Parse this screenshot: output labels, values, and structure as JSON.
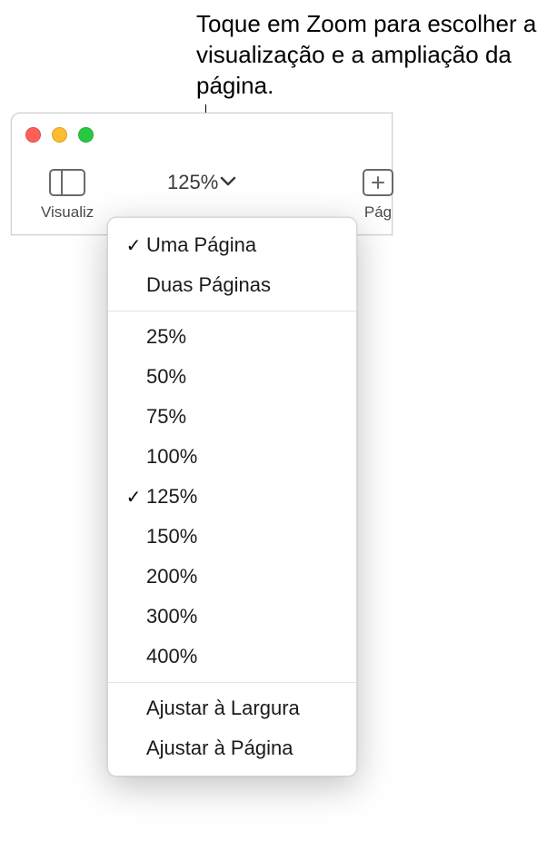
{
  "callout": {
    "text": "Toque em Zoom para escolher a visualização e a ampliação da página."
  },
  "toolbar": {
    "view_label": "Visualiz",
    "zoom_value": "125%",
    "page_label": "Pág"
  },
  "menu": {
    "view_modes": [
      {
        "label": "Uma Página",
        "checked": true
      },
      {
        "label": "Duas Páginas",
        "checked": false
      }
    ],
    "zoom_levels": [
      {
        "label": "25%",
        "checked": false
      },
      {
        "label": "50%",
        "checked": false
      },
      {
        "label": "75%",
        "checked": false
      },
      {
        "label": "100%",
        "checked": false
      },
      {
        "label": "125%",
        "checked": true
      },
      {
        "label": "150%",
        "checked": false
      },
      {
        "label": "200%",
        "checked": false
      },
      {
        "label": "300%",
        "checked": false
      },
      {
        "label": "400%",
        "checked": false
      }
    ],
    "fit_options": [
      {
        "label": "Ajustar à Largura"
      },
      {
        "label": "Ajustar à Página"
      }
    ]
  }
}
